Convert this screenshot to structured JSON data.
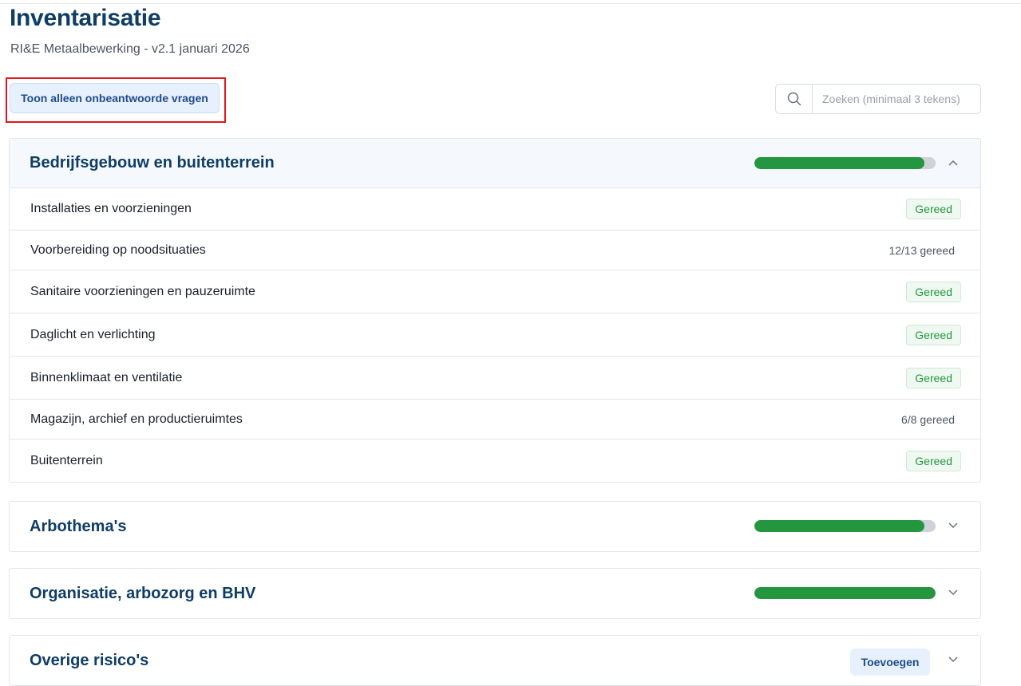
{
  "page": {
    "title": "Inventarisatie",
    "subtitle": "RI&E Metaalbewerking - v2.1 januari 2026"
  },
  "toolbar": {
    "filter_label": "Toon alleen onbeantwoorde vragen",
    "search_placeholder": "Zoeken (minimaal 3 tekens)"
  },
  "sections": [
    {
      "title": "Bedrijfsgebouw en buitenterrein",
      "expanded": true,
      "progress": 0.94,
      "items": [
        {
          "label": "Installaties en voorzieningen",
          "status": "Gereed"
        },
        {
          "label": "Voorbereiding op noodsituaties",
          "status": "12/13 gereed"
        },
        {
          "label": "Sanitaire voorzieningen en pauzeruimte",
          "status": "Gereed"
        },
        {
          "label": "Daglicht en verlichting",
          "status": "Gereed"
        },
        {
          "label": "Binnenklimaat en ventilatie",
          "status": "Gereed"
        },
        {
          "label": "Magazijn, archief en productieruimtes",
          "status": "6/8 gereed"
        },
        {
          "label": "Buitenterrein",
          "status": "Gereed"
        }
      ]
    },
    {
      "title": "Arbothema's",
      "expanded": false,
      "progress": 0.94
    },
    {
      "title": "Organisatie, arbozorg en BHV",
      "expanded": false,
      "progress": 1.0
    },
    {
      "title": "Overige risico's",
      "expanded": false,
      "add_label": "Toevoegen"
    }
  ],
  "colors": {
    "accent": "#0f3d66",
    "progress_fill": "#23963f",
    "done_badge": "#23963f",
    "highlight": "#e2151a"
  }
}
